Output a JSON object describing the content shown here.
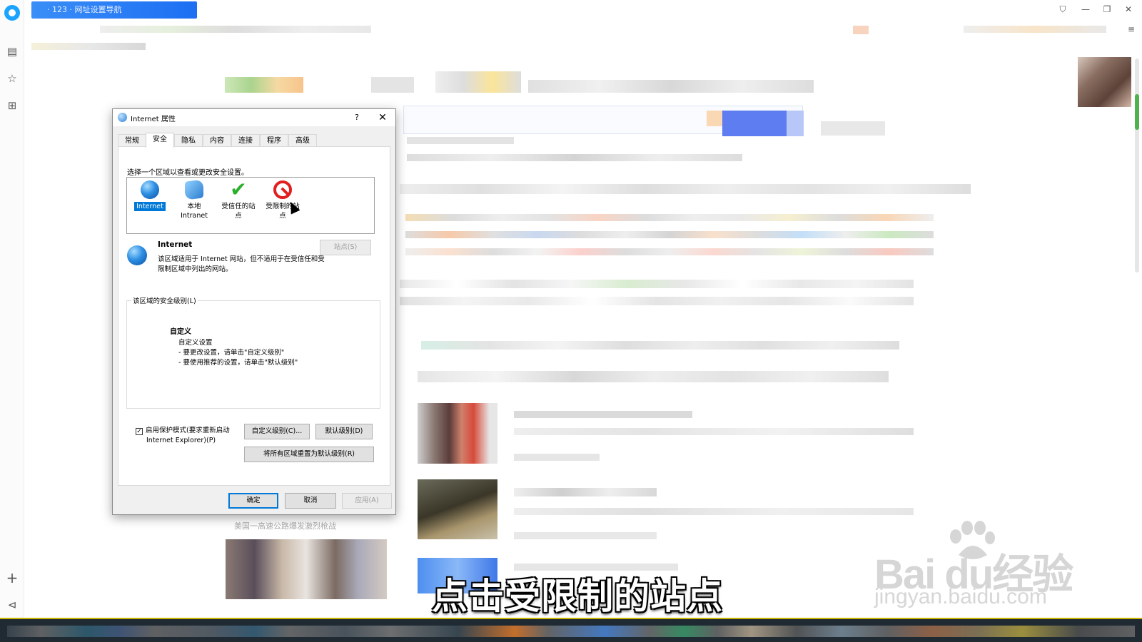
{
  "browser": {
    "tab_title": "· 123 · 网址设置导航",
    "left_rail_icons": [
      "browser-logo-icon",
      "reader-icon",
      "star-icon",
      "translate-icon",
      "plus-icon",
      "collapse-icon"
    ],
    "window_controls": [
      "shirt-icon",
      "minimize-icon",
      "restore-icon",
      "close-icon"
    ],
    "menu_icon": "≡"
  },
  "dialog": {
    "title": "Internet 属性",
    "help_label": "?",
    "close_label": "✕",
    "tabs": [
      {
        "label": "常规"
      },
      {
        "label": "安全"
      },
      {
        "label": "隐私"
      },
      {
        "label": "内容"
      },
      {
        "label": "连接"
      },
      {
        "label": "程序"
      },
      {
        "label": "高级"
      }
    ],
    "active_tab": "安全",
    "zone_instruction": "选择一个区域以查看或更改安全设置。",
    "zones": [
      {
        "label": "Internet",
        "icon": "globe-icon",
        "selected": true
      },
      {
        "label_line1": "本地",
        "label_line2": "Intranet",
        "icon": "intranet-icon"
      },
      {
        "label_line1": "受信任的站",
        "label_line2": "点",
        "icon": "check-icon"
      },
      {
        "label_line1": "受限制的站",
        "label_line2": "点",
        "icon": "blocked-icon"
      }
    ],
    "zone_desc": {
      "title": "Internet",
      "text": "该区域适用于 Internet 网站，但不适用于在受信任和受限制区域中列出的网站。",
      "sites_button": "站点(S)"
    },
    "security_level": {
      "group_label": "该区域的安全级别(L)",
      "level_title": "自定义",
      "line1": "自定义设置",
      "line2": "- 要更改设置，请单击\"自定义级别\"",
      "line3": "- 要使用推荐的设置，请单击\"默认级别\""
    },
    "protected_mode": {
      "checked": true,
      "label_line1": "启用保护模式(要求重新启动",
      "label_line2": "Internet Explorer)(P)"
    },
    "custom_level_button": "自定义级别(C)...",
    "default_level_button": "默认级别(D)",
    "reset_all_button": "将所有区域重置为默认级别(R)",
    "ok_button": "确定",
    "cancel_button": "取消",
    "apply_button": "应用(A)"
  },
  "overlay": {
    "subtitle": "点击受限制的站点",
    "watermark_main": "Bai du经验",
    "watermark_sub": "jingyan.baidu.com"
  },
  "background_page": {
    "faint_caption": "美国一高速公路爆发激烈枪战"
  },
  "colors": {
    "accent": "#0078d7",
    "tab_blue": "#1d6ff3",
    "taskbar": "#1f2a33",
    "taskbar_border": "#c8b400"
  }
}
